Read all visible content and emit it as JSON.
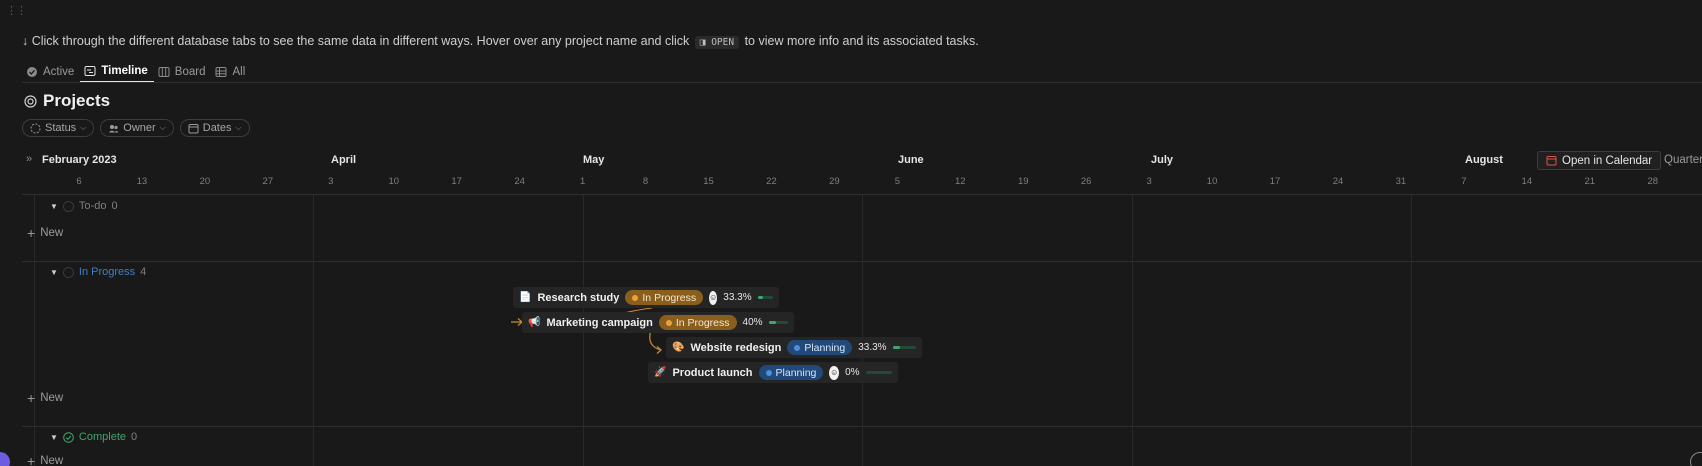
{
  "hint": {
    "before": "↓ Click through the different database tabs to see the same data in different ways. Hover over any project name and click",
    "code": "◨ OPEN",
    "after": "to view more info and its associated tasks."
  },
  "tabs": [
    {
      "label": "Active",
      "icon": "check-circle-icon"
    },
    {
      "label": "Timeline",
      "icon": "timeline-icon",
      "active": true
    },
    {
      "label": "Board",
      "icon": "board-icon"
    },
    {
      "label": "All",
      "icon": "table-icon"
    }
  ],
  "title": "Projects",
  "filters": {
    "status": "Status",
    "owner": "Owner",
    "dates": "Dates"
  },
  "timeline": {
    "months": [
      "February 2023",
      "April",
      "May",
      "June",
      "July",
      "August"
    ],
    "days": [
      "6",
      "13",
      "20",
      "27",
      "3",
      "10",
      "17",
      "24",
      "1",
      "8",
      "15",
      "22",
      "29",
      "5",
      "12",
      "19",
      "26",
      "3",
      "10",
      "17",
      "24",
      "31",
      "7",
      "14",
      "21",
      "28"
    ],
    "open_in_calendar": "Open in Calendar",
    "zoom": "Quarter"
  },
  "groups": {
    "todo": {
      "label": "To-do",
      "count": "0",
      "color": "#7f7f7f"
    },
    "in_progress": {
      "label": "In Progress",
      "count": "4",
      "color": "#3f7fc4"
    },
    "complete": {
      "label": "Complete",
      "count": "0",
      "color": "#3fa56d"
    }
  },
  "new_label": "New",
  "projects": [
    {
      "name": "Research study",
      "status": "In Progress",
      "percent": "33.3%",
      "progress": 0.333,
      "icon": "document-icon"
    },
    {
      "name": "Marketing campaign",
      "status": "In Progress",
      "percent": "40%",
      "progress": 0.4,
      "icon": "megaphone-icon"
    },
    {
      "name": "Website redesign",
      "status": "Planning",
      "percent": "33.3%",
      "progress": 0.333,
      "icon": "palette-icon"
    },
    {
      "name": "Product launch",
      "status": "Planning",
      "percent": "0%",
      "progress": 0,
      "icon": "rocket-icon"
    }
  ]
}
